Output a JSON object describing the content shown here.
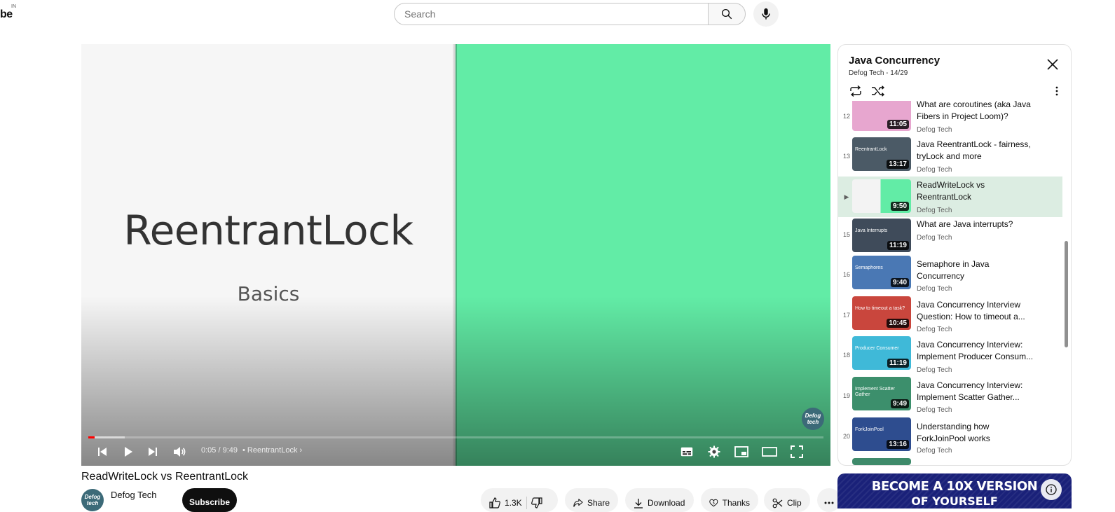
{
  "header": {
    "logo_fragment": "be",
    "logo_country": "IN",
    "search_placeholder": "Search"
  },
  "player": {
    "slide_title": "ReentrantLock",
    "slide_subtitle": "Basics",
    "watermark": "Defog tech",
    "current_time": "0:05 / 9:49",
    "chapter": "• ReentrantLock",
    "progress_played_fraction": 0.0085,
    "colors": {
      "slide_left": "#f6f6f6",
      "slide_right": "#62eca6",
      "progress": "#ff0000"
    }
  },
  "video": {
    "title": "ReadWriteLock vs ReentrantLock",
    "channel": "Defog Tech",
    "avatar_text": "Defog tech",
    "subscribe_label": "Subscribe",
    "like_count": "1.3K",
    "share_label": "Share",
    "download_label": "Download",
    "thanks_label": "Thanks",
    "clip_label": "Clip"
  },
  "playlist": {
    "title": "Java Concurrency",
    "subtitle": "Defog Tech - 14/29",
    "items": [
      {
        "index": "12",
        "title": "What are coroutines (aka Java Fibers in Project Loom)?",
        "channel": "Defog Tech",
        "duration": "11:05",
        "thumb_color": "#e7a6cf",
        "thumb_text": ""
      },
      {
        "index": "13",
        "title": "Java ReentrantLock - fairness, tryLock and more",
        "channel": "Defog Tech",
        "duration": "13:17",
        "thumb_color": "#4b5a66",
        "thumb_text": "ReentrantLock"
      },
      {
        "index": "▶",
        "title": "ReadWriteLock vs ReentrantLock",
        "channel": "Defog Tech",
        "duration": "9:50",
        "thumb_color": "#62eca6",
        "thumb_text": "",
        "active": true
      },
      {
        "index": "15",
        "title": "What are Java interrupts?",
        "channel": "Defog Tech",
        "duration": "11:19",
        "thumb_color": "#3f4b5a",
        "thumb_text": "Java Interrupts"
      },
      {
        "index": "16",
        "title": "Semaphore in Java Concurrency",
        "channel": "Defog Tech",
        "duration": "9:40",
        "thumb_color": "#4a78b4",
        "thumb_text": "Semaphores"
      },
      {
        "index": "17",
        "title": "Java Concurrency Interview Question: How to timeout a...",
        "channel": "Defog Tech",
        "duration": "10:45",
        "thumb_color": "#c9463d",
        "thumb_text": "How to timeout a task?"
      },
      {
        "index": "18",
        "title": "Java Concurrency Interview: Implement Producer Consum...",
        "channel": "Defog Tech",
        "duration": "11:19",
        "thumb_color": "#3fb9d8",
        "thumb_text": "Producer Consumer"
      },
      {
        "index": "19",
        "title": "Java Concurrency Interview: Implement Scatter Gather...",
        "channel": "Defog Tech",
        "duration": "9:49",
        "thumb_color": "#3c8f6c",
        "thumb_text": "Implement Scatter Gather"
      },
      {
        "index": "20",
        "title": "Understanding how ForkJoinPool works",
        "channel": "Defog Tech",
        "duration": "13:16",
        "thumb_color": "#2e4d8f",
        "thumb_text": "ForkJoinPool"
      }
    ]
  },
  "ad": {
    "line1": "BECOME A 10X VERSION",
    "line2": "OF YOURSELF",
    "bg": "#1a2179"
  }
}
